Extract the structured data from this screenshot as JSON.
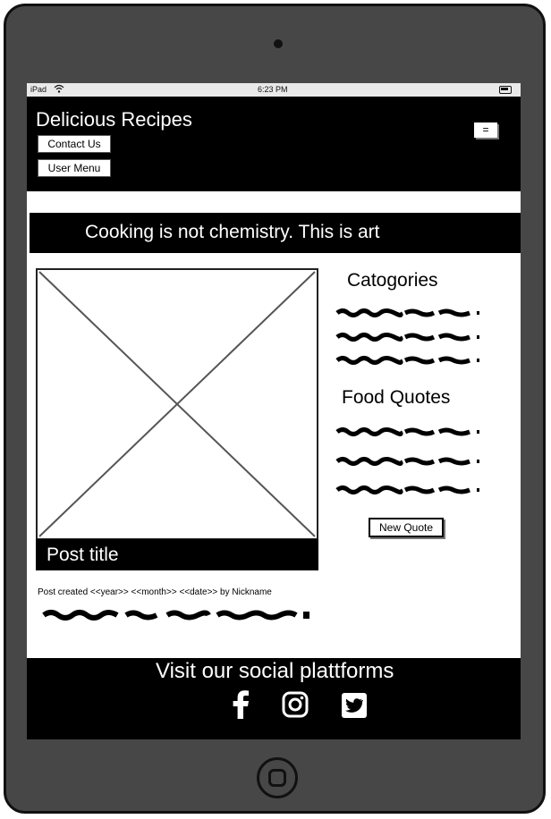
{
  "device": {
    "name": "iPad"
  },
  "status_bar": {
    "carrier": "iPad",
    "time": "6:23 PM"
  },
  "header": {
    "brand": "Delicious Recipes",
    "contact_label": "Contact Us",
    "user_menu_label": "User Menu",
    "menu_icon_text": "="
  },
  "hero": {
    "tagline": "Cooking is not chemistry. This is art"
  },
  "post": {
    "title": "Post title",
    "meta": "Post created  <<year>> <<month>> <<date>> by Nickname"
  },
  "sidebar": {
    "categories_heading": "Catogories",
    "quotes_heading": "Food Quotes",
    "new_quote_label": "New Quote"
  },
  "footer": {
    "title": "Visit our social plattforms",
    "social_icons": [
      "facebook-icon",
      "instagram-icon",
      "twitter-icon"
    ]
  }
}
